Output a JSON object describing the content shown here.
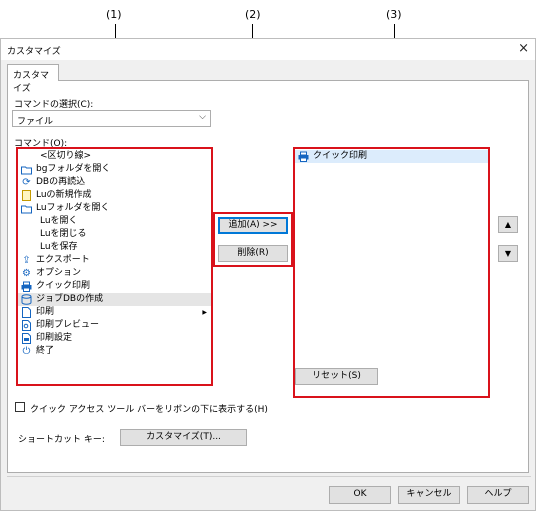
{
  "callouts": [
    "(1)",
    "(2)",
    "(3)"
  ],
  "window": {
    "title": "カスタマイズ",
    "close_icon": "×"
  },
  "tab": {
    "label": "カスタマイズ"
  },
  "command_select": {
    "label": "コマンドの選択(C):",
    "value": "ファイル"
  },
  "command_list": {
    "label": "コマンド(O):",
    "items": [
      {
        "label": "<区切り線>",
        "icon": ""
      },
      {
        "label": "bgフォルダを開く",
        "icon": "folder-icon"
      },
      {
        "label": "DBの再読込",
        "icon": "refresh-icon"
      },
      {
        "label": "Luの新規作成",
        "icon": "new-file-icon"
      },
      {
        "label": "Luフォルダを開く",
        "icon": "folder-icon"
      },
      {
        "label": "Luを開く",
        "icon": ""
      },
      {
        "label": "Luを閉じる",
        "icon": ""
      },
      {
        "label": "Luを保存",
        "icon": ""
      },
      {
        "label": "エクスポート",
        "icon": "export-icon"
      },
      {
        "label": "オプション",
        "icon": "options-icon"
      },
      {
        "label": "クイック印刷",
        "icon": "printer-icon"
      },
      {
        "label": "ジョブDBの作成",
        "icon": "database-icon"
      },
      {
        "label": "印刷",
        "icon": "document-icon"
      },
      {
        "label": "印刷プレビュー",
        "icon": "preview-icon"
      },
      {
        "label": "印刷設定",
        "icon": "print-settings-icon"
      },
      {
        "label": "終了",
        "icon": "exit-icon"
      }
    ],
    "selected_index": 11
  },
  "buttons": {
    "add": "追加(A) >>",
    "remove": "削除(R)",
    "reset": "リセット(S)",
    "move_up": "▲",
    "move_down": "▼",
    "customize": "カスタマイズ(T)...",
    "ok": "OK",
    "cancel": "キャンセル",
    "help": "ヘルプ"
  },
  "toolbar_list": {
    "items": [
      {
        "label": "クイック印刷",
        "icon": "printer-icon"
      }
    ]
  },
  "checkbox": {
    "label": "クイック アクセス ツール バーをリボンの下に表示する(H)",
    "checked": false
  },
  "shortcut": {
    "label": "ショートカット キー:"
  },
  "colors": {
    "highlight": "#d9121b",
    "accent": "#0078d7"
  }
}
